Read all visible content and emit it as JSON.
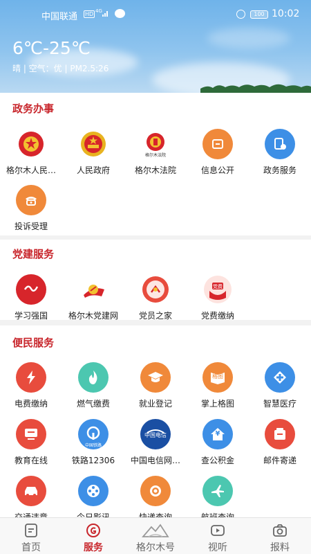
{
  "status_bar": {
    "carrier": "中国联通",
    "hd": "HD",
    "signal": "4G",
    "battery": "100",
    "time": "10:02"
  },
  "weather": {
    "temperature": "6℃-25℃",
    "detail": "晴 | 空气：优 | PM2.5:26"
  },
  "sections": {
    "gov": {
      "title": "政务办事",
      "items": [
        "格尔木人民…",
        "人民政府",
        "格尔木法院",
        "信息公开",
        "政务服务",
        "投诉受理"
      ]
    },
    "party": {
      "title": "党建服务",
      "items": [
        "学习强国",
        "格尔木党建网",
        "党员之家",
        "党费缴纳"
      ]
    },
    "life": {
      "title": "便民服务",
      "items": [
        "电费缴纳",
        "燃气缴费",
        "就业登记",
        "掌上格图",
        "智慧医疗",
        "教育在线",
        "铁路12306",
        "中国电信网…",
        "查公积金",
        "邮件寄递",
        "交通违章",
        "今日影讯",
        "快递查询",
        "航班查询"
      ]
    }
  },
  "icon_text": {
    "court": "格尔木法院",
    "party_dues": "党费",
    "telecom_cn": "中国电信",
    "rail": "中国铁路",
    "map": "格图",
    "fund": "¥"
  },
  "tabs": [
    "首页",
    "服务",
    "格尔木号",
    "视听",
    "报料"
  ],
  "colors": {
    "accent": "#c8262c",
    "orange": "#f0893a",
    "blue": "#3d8fe6",
    "teal": "#4cc7b0",
    "red": "#e84c3d"
  }
}
